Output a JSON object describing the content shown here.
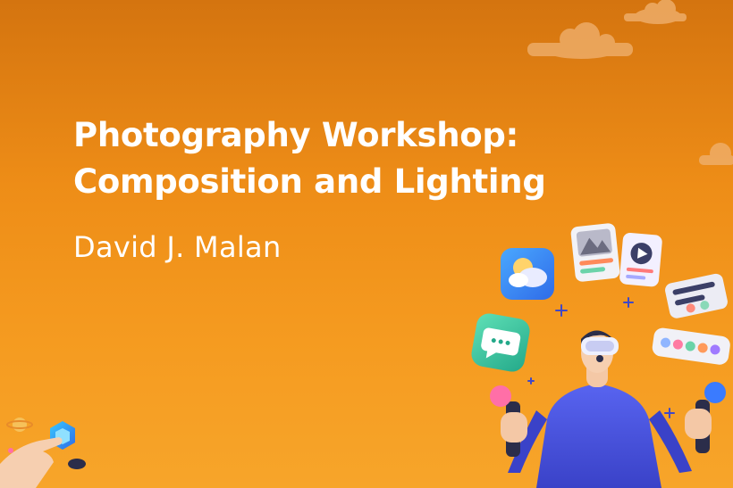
{
  "title_lines": [
    "Photography Workshop:",
    "Composition and Lighting"
  ],
  "author": "David J. Malan",
  "colors": {
    "background_top": "#d4740f",
    "background_bottom": "#f7a52a",
    "text": "#ffffff",
    "figure_shirt": "#4a55e6"
  },
  "decorations": [
    "cloud-icon",
    "cloud-icon",
    "cloud-icon",
    "image-app-icon",
    "photo-card-icon",
    "video-play-card-icon",
    "chat-bubble-icon",
    "settings-slider-card-icon",
    "color-palette-icon",
    "vr-headset-person",
    "microphone-icon",
    "planet-icon",
    "pointing-hand-icon"
  ]
}
